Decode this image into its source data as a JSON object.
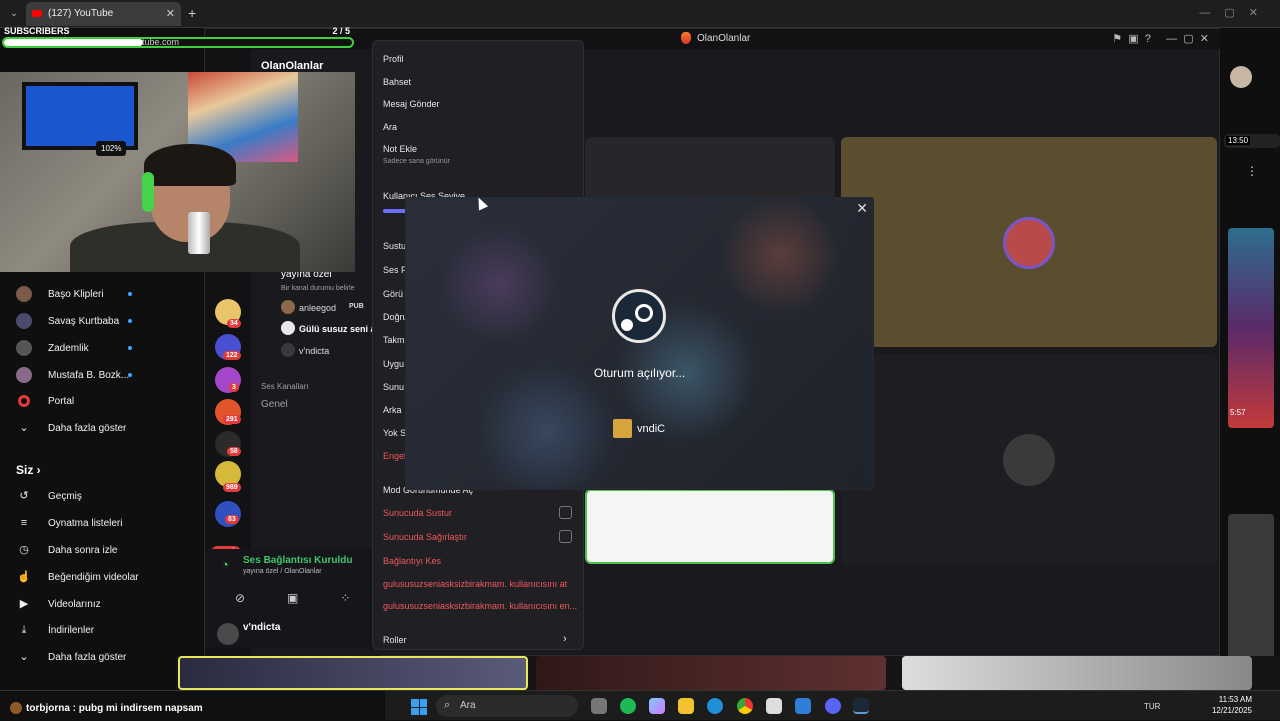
{
  "browser": {
    "tab_title": "(127) YouTube",
    "tab_close": "✕",
    "new_tab": "+",
    "url_fragment": "tube.com"
  },
  "subscribers": {
    "label": "SUBSCRIBERS",
    "count": "2 / 5",
    "progress_fraction": 0.4
  },
  "yt_sidebar": {
    "subscriptions": [
      {
        "label": "Başo Klipleri",
        "live_dot": true
      },
      {
        "label": "Savaş Kurtbaba",
        "live_dot": true
      },
      {
        "label": "Zademlik",
        "live_dot": true
      },
      {
        "label": "Mustafa B. Bozk...",
        "live_dot": true
      },
      {
        "label": "Portal",
        "live_dot": false
      },
      {
        "label": "Daha fazla göster",
        "live_dot": false
      }
    ],
    "you_section": "Siz",
    "you_items": [
      {
        "label": "Geçmiş"
      },
      {
        "label": "Oynatma listeleri"
      },
      {
        "label": "Daha sonra izle"
      },
      {
        "label": "Beğendiğim videolar"
      },
      {
        "label": "Videolarınız"
      },
      {
        "label": "İndirilenler"
      },
      {
        "label": "Daha fazla göster"
      }
    ]
  },
  "discord": {
    "window_title": "OlanOlanlar",
    "server_name": "OlanOlanlar",
    "channels": {
      "stage_channel": "yayına özel",
      "stage_hint": "Bir kanal durumu belirle",
      "members": [
        "anleegod",
        "Gülü susuz seni a",
        "v'ndicta"
      ],
      "members_tag": "PUB",
      "voice_category": "Ses Kanalları",
      "voice_channel": "Genel"
    },
    "server_badges": [
      "34",
      "122",
      "3",
      "291",
      "58",
      "989",
      "83"
    ],
    "new_badge": "YENİ",
    "voice_panel": {
      "status": "Ses Bağlantısı Kuruldu",
      "location": "yayına özel / OlanOlanlar",
      "username": "v'ndicta"
    }
  },
  "context_menu": {
    "items_top": [
      "Profil",
      "Bahset",
      "Mesaj Gönder",
      "Ara",
      "Not Ekle"
    ],
    "note_hint": "Sadece sana görünür",
    "volume_label": "Kullanıcı Ses Seviye",
    "volume_value": "102%",
    "volume_fraction": 0.125,
    "items_mid": [
      "Sustu",
      "Ses P",
      "Görü",
      "Doğru",
      "Takm",
      "Uygu",
      "Sunu",
      "Arka",
      "Yok S"
    ],
    "block_item": "Engel",
    "mod_header": "Mod Görünümünde Aç",
    "server_mute": "Sunucuda Sustur",
    "server_deafen": "Sunucuda Sağırlaştır",
    "disconnect": "Bağlantıyı Kes",
    "kick": "gulususuzseniasksizbirakmam. kullanıcısını at",
    "ban": "gulususuzseniasksizbirakmam. kullanıcısını en...",
    "roles": "Roller"
  },
  "steam_dialog": {
    "status": "Oturum açılıyor...",
    "username": "vndiC",
    "close": "✕"
  },
  "right_col": {
    "duration_top": "13:50",
    "duration_mid": "5:57"
  },
  "taskbar": {
    "chat_user": "torbjorna",
    "chat_message": ": pubg mi indirsem napsam",
    "search_placeholder": "Ara",
    "language": "TUR",
    "time": "11:53 AM",
    "date": "12/21/2025"
  },
  "colors": {
    "discord_bg": "#1a1a1e",
    "accent_green": "#45c46c",
    "danger_red": "#f0595c",
    "volume_blue": "#6d6dff"
  }
}
